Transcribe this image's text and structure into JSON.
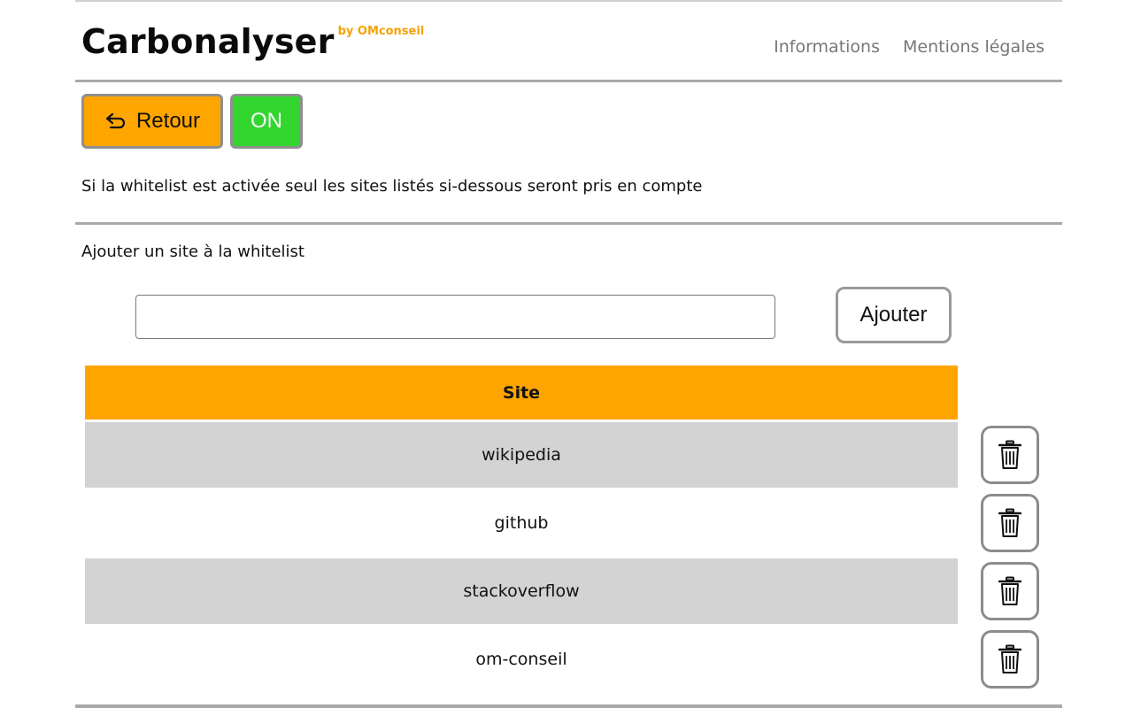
{
  "header": {
    "title": "Carbonalyser",
    "subtitle": "by OMconseil",
    "nav": [
      {
        "label": "Informations"
      },
      {
        "label": "Mentions légales"
      }
    ]
  },
  "toolbar": {
    "back_label": "Retour",
    "back_icon": "return-arrow-icon",
    "toggle_label": "ON"
  },
  "whitelist": {
    "description": "Si la whitelist est activée seul les sites listés si-dessous seront pris en compte",
    "add_section_label": "Ajouter un site à la whitelist",
    "input_value": "",
    "input_placeholder": "",
    "add_button_label": "Ajouter",
    "table": {
      "column_header": "Site",
      "rows": [
        "wikipedia",
        "github",
        "stackoverflow",
        "om-conseil"
      ],
      "delete_icon": "trash-icon"
    }
  },
  "colors": {
    "accent": "#ffa500",
    "toggle_on": "#32d62f",
    "row_shade": "#d3d3d3",
    "nav_text": "#777777"
  }
}
